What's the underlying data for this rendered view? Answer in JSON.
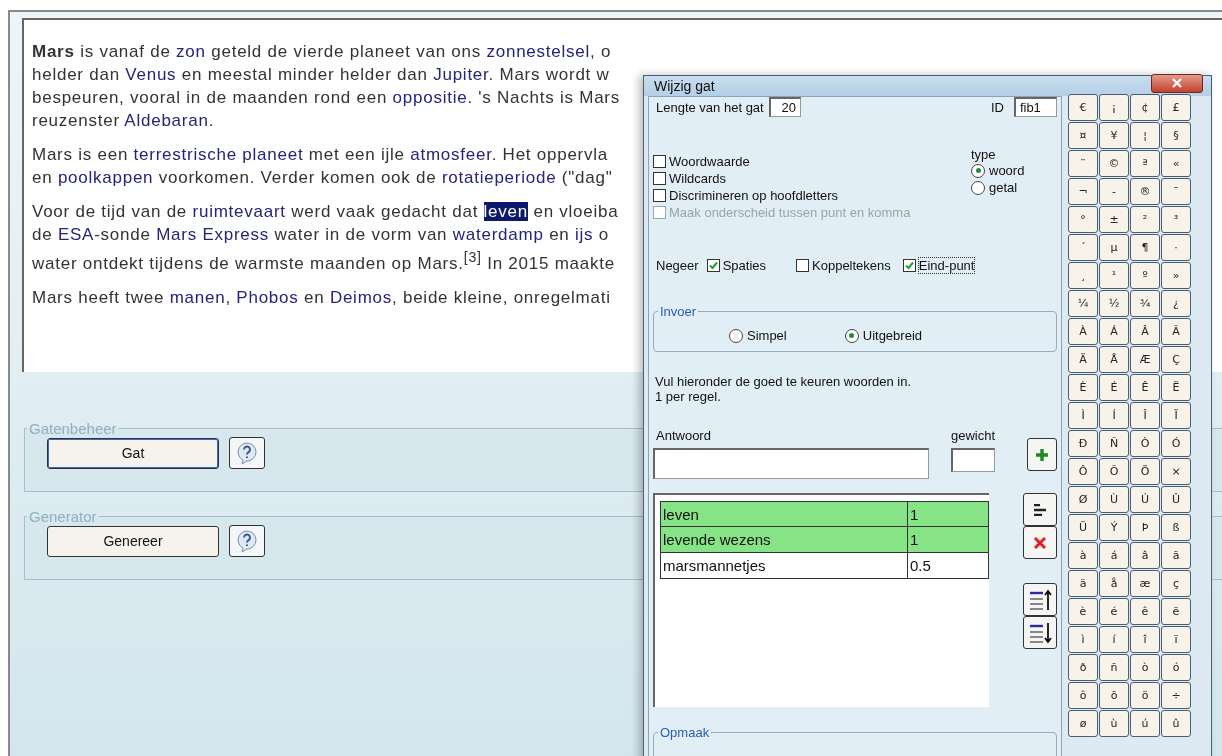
{
  "editor": {
    "paragraphs": [
      {
        "lines": [
          [
            {
              "kind": "bold",
              "t": "Mars"
            },
            {
              "kind": "text",
              "t": " is vanaf de "
            },
            {
              "kind": "link",
              "t": "zon"
            },
            {
              "kind": "text",
              "t": " geteld de vierde planeet van ons "
            },
            {
              "kind": "link",
              "t": "zonnestelsel"
            },
            {
              "kind": "text",
              "t": ", o"
            }
          ],
          [
            {
              "kind": "text",
              "t": "helder dan "
            },
            {
              "kind": "link",
              "t": "Venus"
            },
            {
              "kind": "text",
              "t": " en meestal minder helder dan "
            },
            {
              "kind": "link",
              "t": "Jupiter"
            },
            {
              "kind": "text",
              "t": ". Mars wordt w"
            }
          ],
          [
            {
              "kind": "text",
              "t": "bespeuren, vooral in de maanden rond een "
            },
            {
              "kind": "link",
              "t": "oppositie"
            },
            {
              "kind": "text",
              "t": ". 's Nachts is Mars"
            }
          ],
          [
            {
              "kind": "text",
              "t": "reuzenster "
            },
            {
              "kind": "link",
              "t": "Aldebaran"
            },
            {
              "kind": "text",
              "t": "."
            }
          ]
        ]
      },
      {
        "lines": [
          [
            {
              "kind": "text",
              "t": "Mars is een "
            },
            {
              "kind": "link",
              "t": "terrestrische planeet"
            },
            {
              "kind": "text",
              "t": " met een ijle "
            },
            {
              "kind": "link",
              "t": "atmosfeer"
            },
            {
              "kind": "text",
              "t": ". Het oppervla"
            }
          ],
          [
            {
              "kind": "text",
              "t": "en "
            },
            {
              "kind": "link",
              "t": "poolkappen"
            },
            {
              "kind": "text",
              "t": " voorkomen. Verder komen ook de "
            },
            {
              "kind": "link",
              "t": "rotatieperiode"
            },
            {
              "kind": "text",
              "t": " (\"dag\""
            }
          ]
        ]
      },
      {
        "lines": [
          [
            {
              "kind": "text",
              "t": "Voor de tijd van de "
            },
            {
              "kind": "link",
              "t": "ruimtevaart"
            },
            {
              "kind": "text",
              "t": " werd vaak gedacht dat "
            },
            {
              "kind": "selected",
              "t": "leven"
            },
            {
              "kind": "text",
              "t": " en vloeiba"
            }
          ],
          [
            {
              "kind": "text",
              "t": "de "
            },
            {
              "kind": "link",
              "t": "ESA"
            },
            {
              "kind": "text",
              "t": "-sonde "
            },
            {
              "kind": "link",
              "t": "Mars Express"
            },
            {
              "kind": "text",
              "t": " water in de vorm van "
            },
            {
              "kind": "link",
              "t": "waterdamp"
            },
            {
              "kind": "text",
              "t": " en "
            },
            {
              "kind": "link",
              "t": "ijs"
            },
            {
              "kind": "text",
              "t": " o"
            }
          ],
          [
            {
              "kind": "text",
              "t": "water ontdekt tijdens de warmste maanden op Mars.$^{[3]}$ In 2015 maakte"
            }
          ]
        ]
      },
      {
        "lines": [
          [
            {
              "kind": "text",
              "t": "Mars heeft twee "
            },
            {
              "kind": "link",
              "t": "manen"
            },
            {
              "kind": "text",
              "t": ", "
            },
            {
              "kind": "link",
              "t": "Phobos"
            },
            {
              "kind": "text",
              "t": " en "
            },
            {
              "kind": "link",
              "t": "Deimos"
            },
            {
              "kind": "text",
              "t": ", beide kleine, onregelmati"
            }
          ]
        ]
      }
    ]
  },
  "groups": [
    {
      "legend": "Gatenbeheer",
      "button": "Gat",
      "focused": true
    },
    {
      "legend": "Generator",
      "button": "Genereer",
      "focused": false
    }
  ],
  "dialog": {
    "title": "Wijzig gat",
    "length": {
      "label": "Lengte van het gat",
      "value": "20"
    },
    "id": {
      "label": "ID",
      "value": "fib1"
    },
    "options": [
      {
        "label": "Woordwaarde",
        "checked": false,
        "disabled": false
      },
      {
        "label": "Wildcards",
        "checked": false,
        "disabled": false
      },
      {
        "label": "Discrimineren op hoofdletters",
        "checked": false,
        "disabled": false
      },
      {
        "label": "Maak onderscheid tussen punt en komma",
        "checked": false,
        "disabled": true
      }
    ],
    "type": {
      "label": "type",
      "options": [
        {
          "label": "woord",
          "selected": true
        },
        {
          "label": "getal",
          "selected": false
        }
      ]
    },
    "ignore": {
      "label": "Negeer",
      "options": [
        {
          "label": "Spaties",
          "checked": true,
          "focused": false
        },
        {
          "label": "Koppeltekens",
          "checked": false,
          "focused": false
        },
        {
          "label": "Eind-punt",
          "checked": true,
          "focused": true
        }
      ]
    },
    "input_mode": {
      "legend": "Invoer",
      "options": [
        {
          "label": "Simpel",
          "selected": false
        },
        {
          "label": "Uitgebreid",
          "selected": true
        }
      ]
    },
    "instructions": [
      "Vul hieronder de goed te keuren woorden in.",
      "1 per regel."
    ],
    "answer_label": "Antwoord",
    "weight_label": "gewicht",
    "answers": [
      {
        "word": "leven",
        "weight": "1",
        "selected": true
      },
      {
        "word": "levende wezens",
        "weight": "1",
        "selected": true
      },
      {
        "word": "marsmannetjes",
        "weight": "0.5",
        "selected": false
      }
    ],
    "format_legend": "Opmaak",
    "characters": [
      [
        "€",
        "¡",
        "¢",
        "£"
      ],
      [
        "¤",
        "¥",
        "¦",
        "§"
      ],
      [
        "¨",
        "©",
        "ª",
        "«"
      ],
      [
        "¬",
        "-",
        "®",
        "¯"
      ],
      [
        "°",
        "±",
        "²",
        "³"
      ],
      [
        "´",
        "µ",
        "¶",
        "·"
      ],
      [
        "¸",
        "¹",
        "º",
        "»"
      ],
      [
        "¼",
        "½",
        "¾",
        "¿"
      ],
      [
        "À",
        "Á",
        "Â",
        "Ã"
      ],
      [
        "Ä",
        "Å",
        "Æ",
        "Ç"
      ],
      [
        "È",
        "É",
        "Ê",
        "Ë"
      ],
      [
        "Ì",
        "Í",
        "Î",
        "Ï"
      ],
      [
        "Ð",
        "Ñ",
        "Ò",
        "Ó"
      ],
      [
        "Ô",
        "Õ",
        "Ö",
        "×"
      ],
      [
        "Ø",
        "Ù",
        "Ú",
        "Û"
      ],
      [
        "Ü",
        "Ý",
        "Þ",
        "ß"
      ],
      [
        "à",
        "á",
        "â",
        "ã"
      ],
      [
        "ä",
        "å",
        "æ",
        "ç"
      ],
      [
        "è",
        "é",
        "ê",
        "ë"
      ],
      [
        "ì",
        "í",
        "î",
        "ï"
      ],
      [
        "ð",
        "ñ",
        "ò",
        "ó"
      ],
      [
        "ô",
        "õ",
        "ö",
        "÷"
      ],
      [
        "ø",
        "ù",
        "ú",
        "û"
      ]
    ]
  }
}
